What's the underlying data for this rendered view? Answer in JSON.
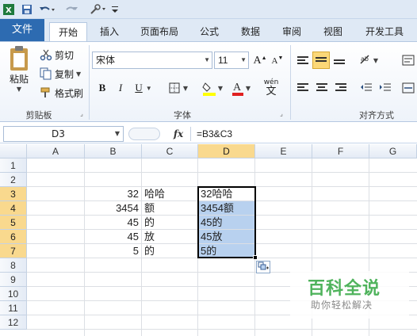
{
  "tabs": {
    "file": "文件",
    "home": "开始",
    "insert": "插入",
    "page_layout": "页面布局",
    "formulas": "公式",
    "data": "数据",
    "review": "审阅",
    "view": "视图",
    "developer": "开发工具"
  },
  "clipboard": {
    "paste": "粘贴",
    "cut": "剪切",
    "copy": "复制",
    "format_painter": "格式刷",
    "group_label": "剪贴板"
  },
  "font": {
    "name": "宋体",
    "size": "11",
    "bold": "B",
    "italic": "I",
    "underline": "U",
    "grow": "A",
    "shrink": "A",
    "wen": "wén",
    "wen_char": "文",
    "group_label": "字体"
  },
  "alignment": {
    "group_label": "对齐方式"
  },
  "formula_bar": {
    "name_box": "D3",
    "fx": "fx",
    "formula": "=B3&C3"
  },
  "columns": [
    "A",
    "B",
    "C",
    "D",
    "E",
    "F",
    "G"
  ],
  "rows": [
    "1",
    "2",
    "3",
    "4",
    "5",
    "6",
    "7",
    "8",
    "9",
    "10",
    "11",
    "12"
  ],
  "cells": {
    "B3": "32",
    "C3": "哈哈",
    "D3": "32哈哈",
    "B4": "3454",
    "C4": "额",
    "D4": "3454额",
    "B5": "45",
    "C5": "的",
    "D5": "45的",
    "B6": "45",
    "C6": "放",
    "D6": "45放",
    "B7": "5",
    "C7": "的",
    "D7": "5的"
  },
  "watermark": {
    "title": "百科全说",
    "subtitle": "助你轻松解决"
  },
  "colors": {
    "accent": "#2d6bb1",
    "selection": "#b8d1ef",
    "header_selected": "#f9d98e",
    "watermark": "#4fb35c"
  }
}
